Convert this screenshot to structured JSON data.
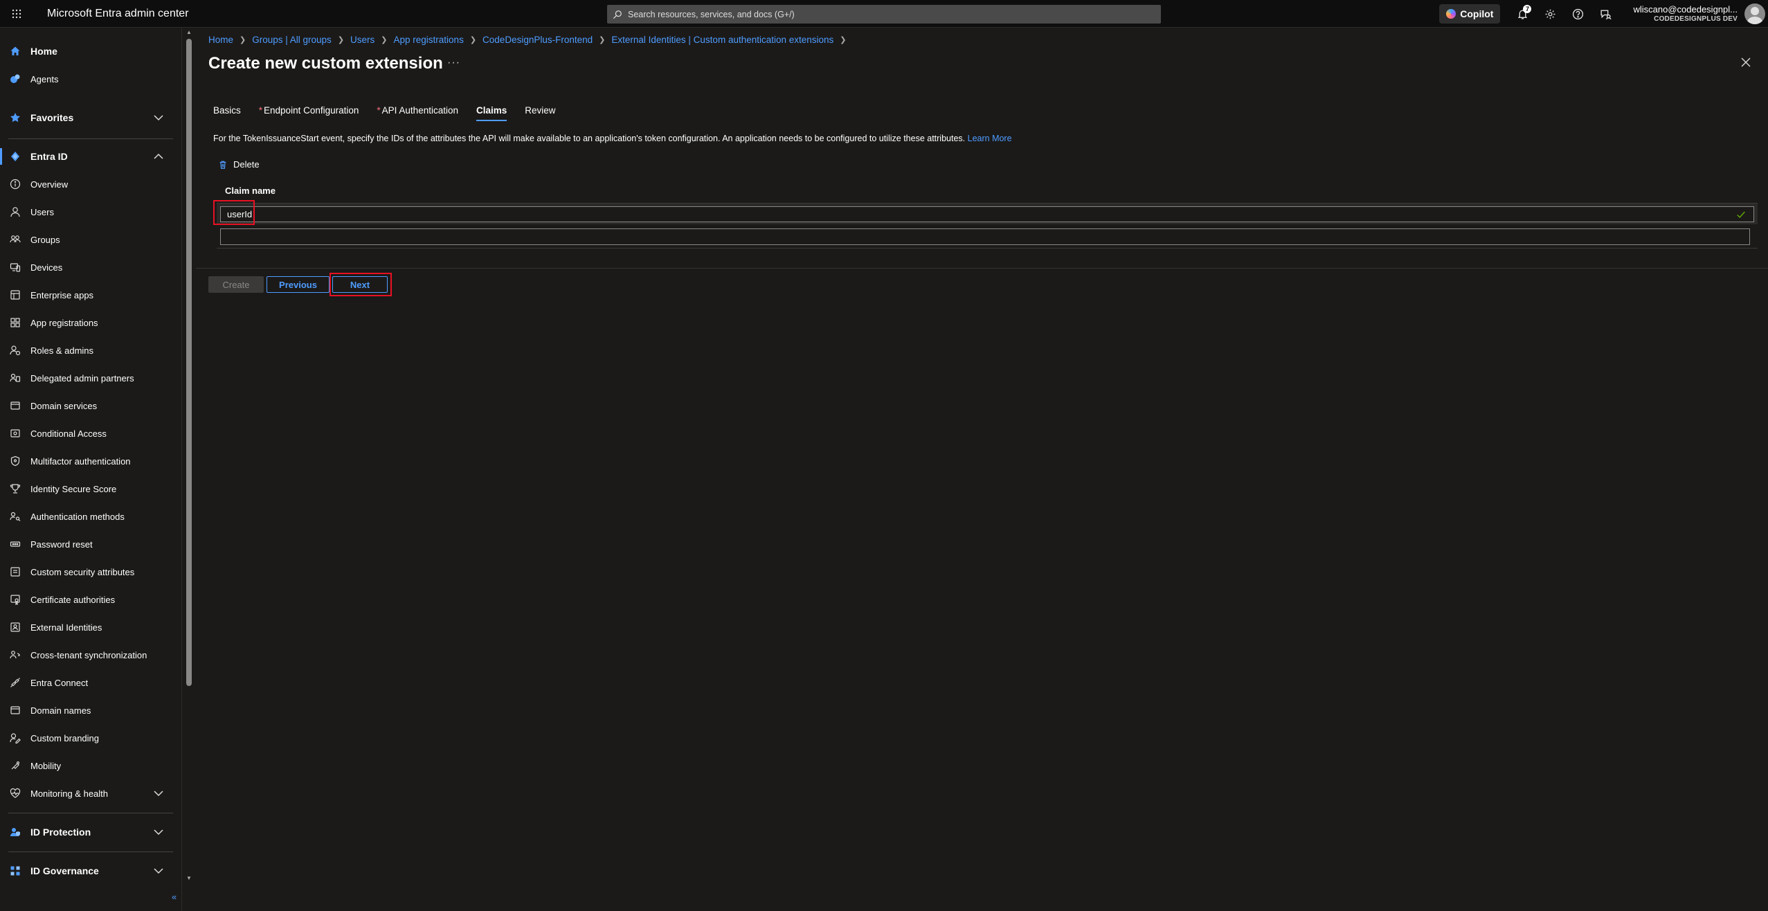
{
  "app": {
    "title": "Microsoft Entra admin center",
    "search_placeholder": "Search resources, services, and docs (G+/)",
    "copilot_label": "Copilot",
    "notification_count": "7",
    "account_name": "wliscano@codedesignpl...",
    "account_org": "CODEDESIGNPLUS DEV"
  },
  "sidebar": {
    "home": "Home",
    "agents": "Agents",
    "favorites": "Favorites",
    "entra_id": "Entra ID",
    "items": [
      {
        "label": "Overview",
        "icon": "info-icon"
      },
      {
        "label": "Users",
        "icon": "user-icon"
      },
      {
        "label": "Groups",
        "icon": "groups-icon"
      },
      {
        "label": "Devices",
        "icon": "devices-icon"
      },
      {
        "label": "Enterprise apps",
        "icon": "enterprise-apps-icon"
      },
      {
        "label": "App registrations",
        "icon": "app-registrations-icon"
      },
      {
        "label": "Roles & admins",
        "icon": "roles-icon"
      },
      {
        "label": "Delegated admin partners",
        "icon": "partners-icon"
      },
      {
        "label": "Domain services",
        "icon": "domain-services-icon"
      },
      {
        "label": "Conditional Access",
        "icon": "conditional-access-icon"
      },
      {
        "label": "Multifactor authentication",
        "icon": "mfa-icon"
      },
      {
        "label": "Identity Secure Score",
        "icon": "secure-score-icon"
      },
      {
        "label": "Authentication methods",
        "icon": "auth-methods-icon"
      },
      {
        "label": "Password reset",
        "icon": "password-reset-icon"
      },
      {
        "label": "Custom security attributes",
        "icon": "custom-attributes-icon"
      },
      {
        "label": "Certificate authorities",
        "icon": "certificate-icon"
      },
      {
        "label": "External Identities",
        "icon": "external-identities-icon"
      },
      {
        "label": "Cross-tenant synchronization",
        "icon": "sync-icon"
      },
      {
        "label": "Entra Connect",
        "icon": "connect-icon"
      },
      {
        "label": "Domain names",
        "icon": "domain-names-icon"
      },
      {
        "label": "Custom branding",
        "icon": "branding-icon"
      },
      {
        "label": "Mobility",
        "icon": "mobility-icon"
      },
      {
        "label": "Monitoring & health",
        "icon": "monitoring-icon"
      }
    ],
    "id_protection": "ID Protection",
    "id_governance": "ID Governance",
    "collapse_glyph": "«"
  },
  "breadcrumb": [
    "Home",
    "Groups | All groups",
    "Users",
    "App registrations",
    "CodeDesignPlus-Frontend",
    "External Identities | Custom authentication extensions"
  ],
  "page": {
    "title": "Create new custom extension",
    "more": "···"
  },
  "tabs": [
    {
      "label": "Basics",
      "required": false,
      "active": false
    },
    {
      "label": "Endpoint Configuration",
      "required": true,
      "active": false
    },
    {
      "label": "API Authentication",
      "required": true,
      "active": false
    },
    {
      "label": "Claims",
      "required": false,
      "active": true
    },
    {
      "label": "Review",
      "required": false,
      "active": false
    }
  ],
  "required_marker": "*",
  "claims": {
    "description": "For the TokenIssuanceStart event, specify the IDs of the attributes the API will make available to an application's token configuration. An application needs to be configured to utilize these attributes.",
    "learn_more": "Learn More",
    "delete_label": "Delete",
    "column_header": "Claim name",
    "rows": [
      "userId",
      ""
    ]
  },
  "footer": {
    "create": "Create",
    "previous": "Previous",
    "next": "Next"
  },
  "colors": {
    "accent": "#4f9cff",
    "highlight": "#e81123",
    "background": "#1b1a19"
  }
}
